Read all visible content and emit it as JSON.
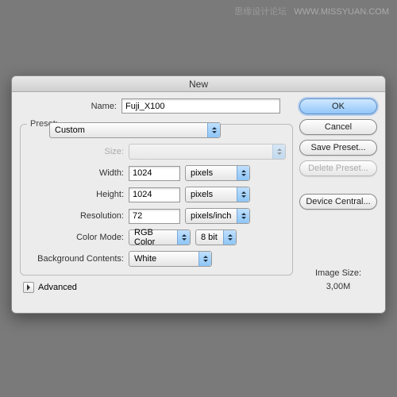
{
  "watermark": {
    "cn": "思缘设计论坛",
    "url": "WWW.MISSYUAN.COM"
  },
  "dialog": {
    "title": "New",
    "name_label": "Name:",
    "name_value": "Fuji_X100",
    "preset_legend": "Preset:",
    "preset_value": "Custom",
    "size_label": "Size:",
    "size_value": "",
    "width_label": "Width:",
    "width_value": "1024",
    "width_unit": "pixels",
    "height_label": "Height:",
    "height_value": "1024",
    "height_unit": "pixels",
    "resolution_label": "Resolution:",
    "resolution_value": "72",
    "resolution_unit": "pixels/inch",
    "colormode_label": "Color Mode:",
    "colormode_value": "RGB Color",
    "bitdepth_value": "8 bit",
    "bg_label": "Background Contents:",
    "bg_value": "White",
    "advanced_label": "Advanced"
  },
  "buttons": {
    "ok": "OK",
    "cancel": "Cancel",
    "save_preset": "Save Preset...",
    "delete_preset": "Delete Preset...",
    "device_central": "Device Central..."
  },
  "image_size": {
    "label": "Image Size:",
    "value": "3,00M"
  }
}
